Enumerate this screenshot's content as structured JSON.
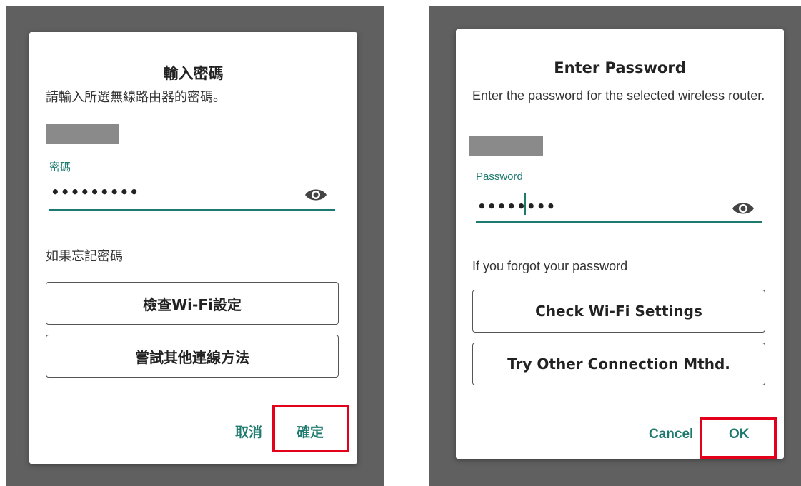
{
  "left": {
    "title": "輸入密碼",
    "description": "請輸入所選無線路由器的密碼。",
    "password_label": "密碼",
    "password_value": "•••••••••",
    "forgot_text": "如果忘記密碼",
    "check_wifi_label": "檢查Wi-Fi設定",
    "try_other_label": "嘗試其他連線方法",
    "cancel_label": "取消",
    "ok_label": "確定"
  },
  "right": {
    "title": "Enter Password",
    "description": "Enter the password for the selected wireless router.",
    "password_label": "Password",
    "password_value": "••••••••",
    "forgot_text": "If you forgot your password",
    "check_wifi_label": "Check Wi-Fi Settings",
    "try_other_label": "Try Other Connection Mthd.",
    "cancel_label": "Cancel",
    "ok_label": "OK"
  },
  "colors": {
    "accent": "#1e7a6f",
    "highlight": "#e3001b",
    "backdrop": "#606060"
  },
  "icons": {
    "show_password": "eye-icon"
  }
}
